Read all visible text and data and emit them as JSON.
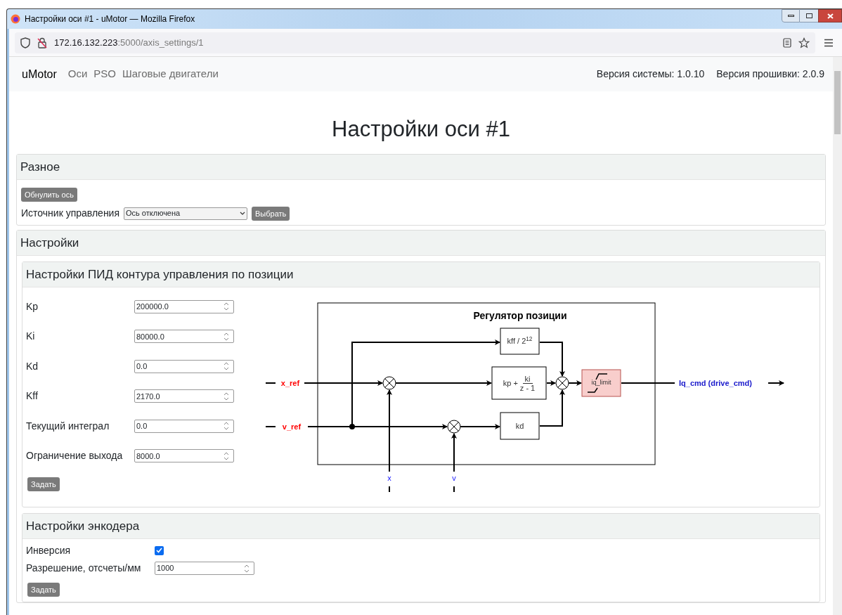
{
  "window": {
    "title": "Настройки оси #1 - uMotor — Mozilla Firefox"
  },
  "address_bar": {
    "host": "172.16.132.223",
    "rest": ":5000/axis_settings/1"
  },
  "navbar": {
    "brand": "uMotor",
    "links": [
      "Оси",
      "PSO",
      "Шаговые двигатели"
    ],
    "versions": [
      "Версия системы: 1.0.10",
      "Версия прошивки: 2.0.9"
    ]
  },
  "page_title": "Настройки оси #1",
  "misc": {
    "title": "Разное",
    "reset_button": "Обнулить ось",
    "source_label": "Источник управления",
    "source_value": "Ось отключена",
    "select_button": "Выбрать"
  },
  "settings": {
    "title": "Настройки",
    "pid": {
      "title": "Настройки ПИД контура управления по позиции",
      "fields": [
        {
          "label": "Kp",
          "value": "200000.0"
        },
        {
          "label": "Ki",
          "value": "80000.0"
        },
        {
          "label": "Kd",
          "value": "0.0"
        },
        {
          "label": "Kff",
          "value": "2170.0"
        },
        {
          "label": "Текущий интеграл",
          "value": "0.0"
        },
        {
          "label": "Ограничение выхода",
          "value": "8000.0"
        }
      ],
      "submit": "Задать",
      "diagram": {
        "title": "Регулятор позиции",
        "inputs": [
          "x_ref",
          "v_ref"
        ],
        "feedback": [
          "x",
          "v"
        ],
        "output": "Iq_cmd (drive_cmd)",
        "blocks": [
          {
            "kind": "text",
            "text": "kff / 2$^{12}$"
          },
          {
            "kind": "fraction",
            "lead": "kp +",
            "numerator": "ki",
            "denominator": "z - 1"
          },
          {
            "kind": "text",
            "text": "kd"
          },
          {
            "kind": "limiter",
            "text": "iq_limit"
          }
        ]
      }
    },
    "encoder": {
      "title": "Настройки энкодера",
      "inversion_label": "Инверсия",
      "inversion_checked": true,
      "resolution_label": "Разрешение, отсчеты/мм",
      "resolution_value": "1000",
      "submit": "Задать"
    }
  }
}
